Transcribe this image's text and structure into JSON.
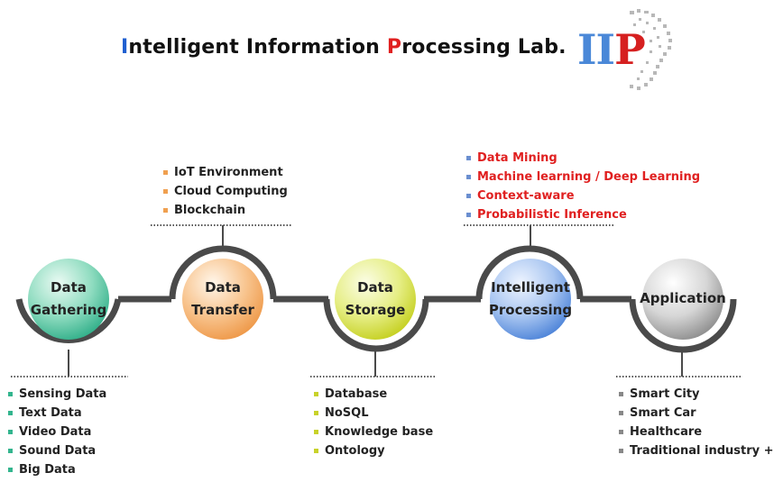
{
  "header": {
    "title_parts": [
      {
        "text": "I",
        "color": "#1f5fd0"
      },
      {
        "text": "ntelligent Information ",
        "color": "#111111"
      },
      {
        "text": "P",
        "color": "#e02020"
      },
      {
        "text": "rocessing Lab.",
        "color": "#111111"
      }
    ],
    "logo": {
      "letters": [
        "I",
        "I",
        "P"
      ],
      "colors": [
        "#4a88d8",
        "#4a88d8",
        "#d62020"
      ]
    }
  },
  "stages": [
    {
      "name": "data-gathering",
      "lines": [
        "Data",
        "Gathering"
      ],
      "color": "#33b58e"
    },
    {
      "name": "data-transfer",
      "lines": [
        "Data",
        "Transfer"
      ],
      "color": "#f0a050"
    },
    {
      "name": "data-storage",
      "lines": [
        "Data",
        "Storage"
      ],
      "color": "#c8d22a"
    },
    {
      "name": "intelligent-processing",
      "lines": [
        "Intelligent",
        "Processing"
      ],
      "color": "#4f86d8"
    },
    {
      "name": "application",
      "lines": [
        "Application"
      ],
      "color": "#8a8a8a"
    }
  ],
  "lists": {
    "gathering": {
      "bullet_color": "#33b58e",
      "items": [
        "Sensing Data",
        "Text Data",
        "Video Data",
        "Sound Data",
        "Big Data"
      ]
    },
    "transfer": {
      "bullet_color": "#f0a050",
      "items": [
        "IoT Environment",
        "Cloud Computing",
        "Blockchain"
      ]
    },
    "storage": {
      "bullet_color": "#c8d22a",
      "items": [
        "Database",
        "NoSQL",
        "Knowledge base",
        "Ontology"
      ]
    },
    "processing": {
      "bullet_color": "#6b8fd0",
      "items": [
        "Data Mining",
        "Machine learning / Deep Learning",
        "Context-aware",
        "Probabilistic Inference"
      ]
    },
    "application": {
      "bullet_color": "#888888",
      "items": [
        "Smart City",
        "Smart Car",
        "Healthcare",
        "Traditional industry + AI"
      ]
    }
  }
}
